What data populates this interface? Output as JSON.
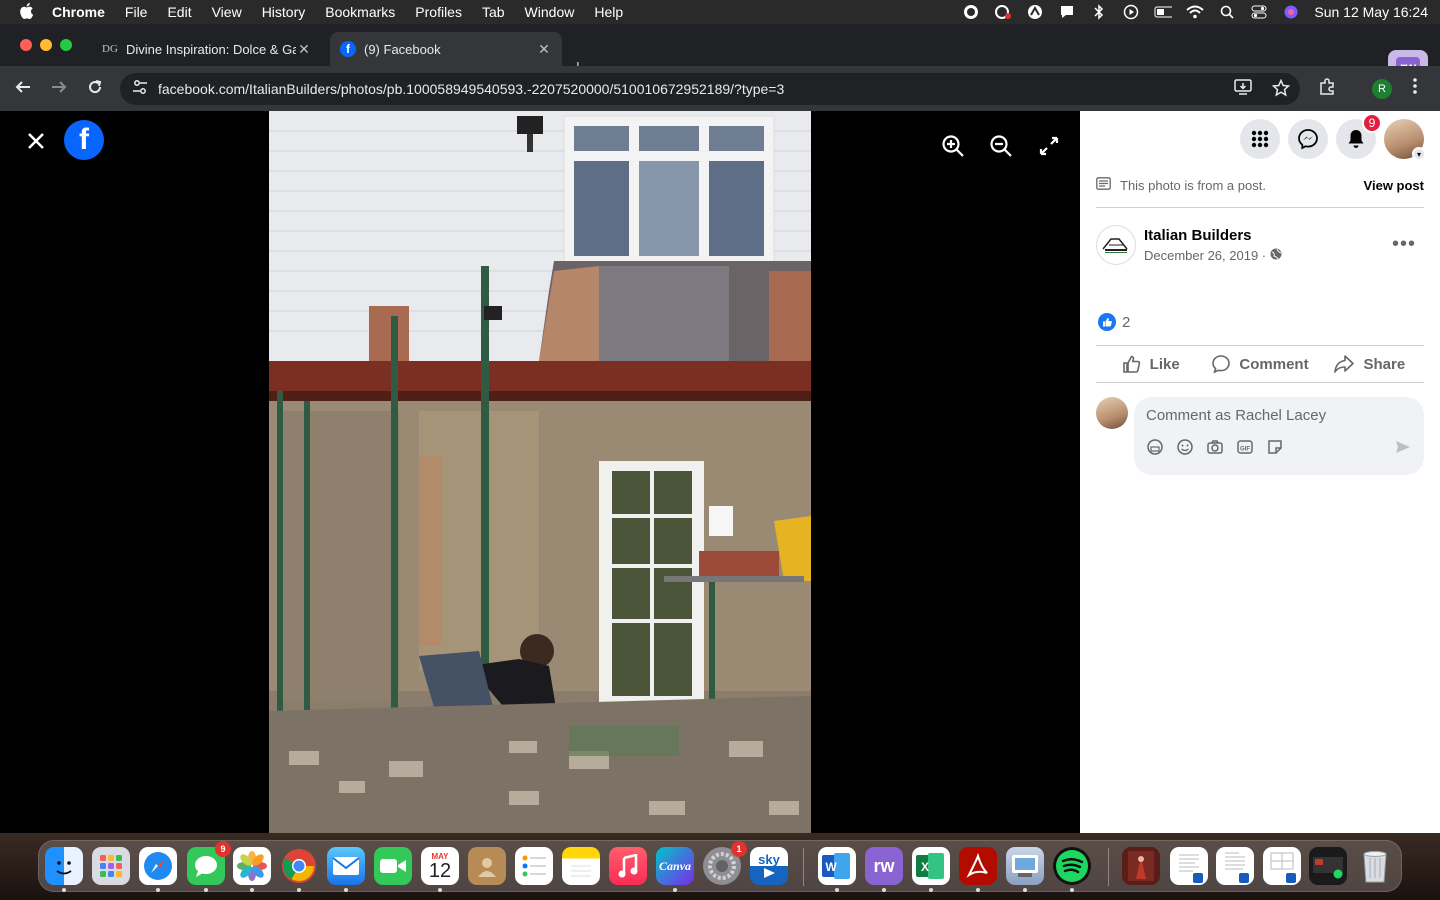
{
  "menubar": {
    "app_name": "Chrome",
    "items": [
      "File",
      "Edit",
      "View",
      "History",
      "Bookmarks",
      "Profiles",
      "Tab",
      "Window",
      "Help"
    ],
    "datetime": "Sun 12 May  16:24"
  },
  "tabs": [
    {
      "title": "Divine Inspiration: Dolce & Ga",
      "active": false
    },
    {
      "title": "(9) Facebook",
      "active": true
    }
  ],
  "address_bar": {
    "url": "facebook.com/ItalianBuilders/photos/pb.100058949540593.-2207520000/510010672952189/?type=3",
    "profile_initial": "R"
  },
  "extension_label": "rw",
  "viewer": {
    "logo_letter": "f"
  },
  "panel": {
    "notification_count": "9",
    "post_note": "This photo is from a post.",
    "view_post": "View post",
    "author_name": "Italian Builders",
    "post_date": "December 26, 2019 ·",
    "reaction_count": "2",
    "actions": {
      "like": "Like",
      "comment": "Comment",
      "share": "Share"
    },
    "comment_placeholder": "Comment as Rachel Lacey"
  },
  "dock": {
    "messages_badge": "9",
    "settings_badge": "1",
    "calendar_month": "MAY",
    "calendar_day": "12",
    "canva_label": "Canva",
    "sky_label": "sky",
    "rw_label": "rw"
  },
  "colors": {
    "facebook_blue": "#0866ff",
    "notification_red": "#e41e3f",
    "like_blue": "#1877f2"
  }
}
